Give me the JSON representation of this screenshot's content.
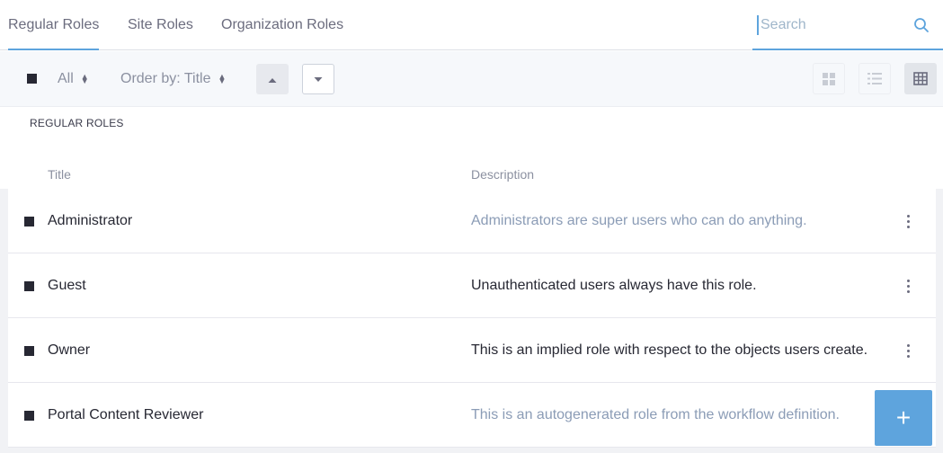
{
  "nav": {
    "tabs": [
      {
        "label": "Regular Roles",
        "active": true
      },
      {
        "label": "Site Roles",
        "active": false
      },
      {
        "label": "Organization Roles",
        "active": false
      }
    ],
    "search_placeholder": "Search",
    "search_icon": "search-icon"
  },
  "toolbar": {
    "filter_label": "All",
    "order_label": "Order by: Title",
    "sort_asc_icon": "caret-up-icon",
    "sort_desc_icon": "caret-down-icon",
    "views": [
      {
        "icon": "cards-view-icon",
        "active": false
      },
      {
        "icon": "list-view-icon",
        "active": false
      },
      {
        "icon": "table-view-icon",
        "active": true
      }
    ]
  },
  "section_label": "REGULAR ROLES",
  "table": {
    "columns": [
      "Title",
      "Description"
    ],
    "rows": [
      {
        "title": "Administrator",
        "description": "Administrators are super users who can do anything.",
        "muted": true
      },
      {
        "title": "Guest",
        "description": "Unauthenticated users always have this role.",
        "muted": false
      },
      {
        "title": "Owner",
        "description": "This is an implied role with respect to the objects users create.",
        "muted": false
      },
      {
        "title": "Portal Content Reviewer",
        "description": "This is an autogenerated role from the workflow definition.",
        "muted": true
      }
    ]
  },
  "fab_label": "+",
  "colors": {
    "accent": "#5ea4dd",
    "text": "#272833",
    "muted_text": "#8b9cb6"
  }
}
